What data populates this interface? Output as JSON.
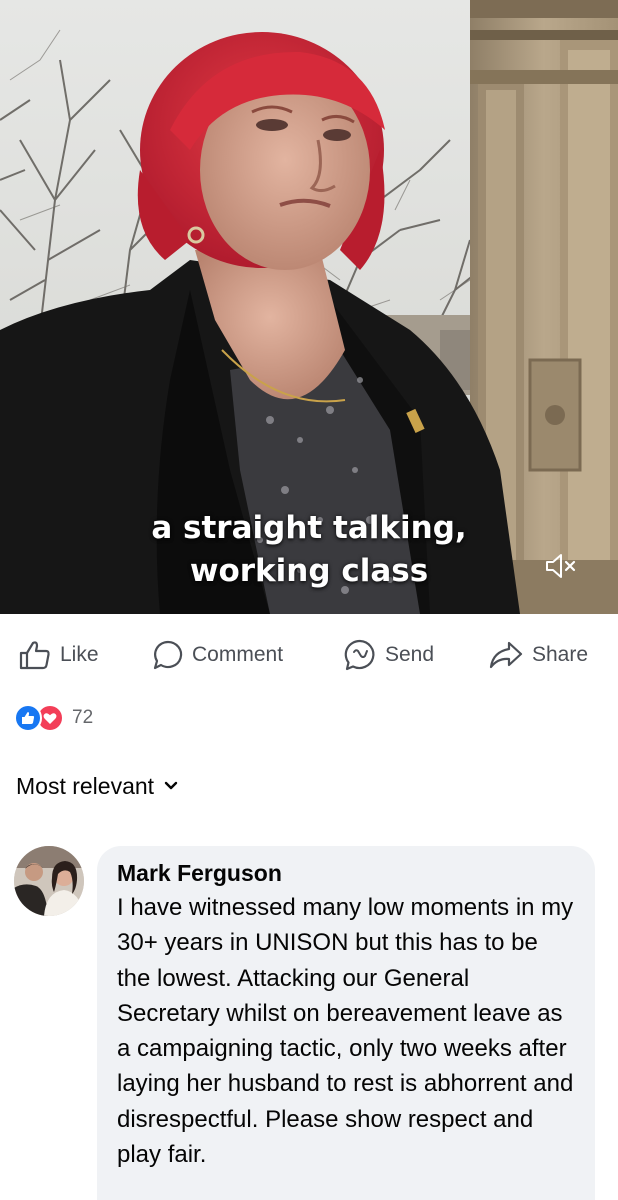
{
  "video": {
    "caption_line1": "a straight talking,",
    "caption_line2": "working class",
    "mute_icon": "speaker-muted-icon"
  },
  "actions": {
    "like_label": "Like",
    "comment_label": "Comment",
    "send_label": "Send",
    "share_label": "Share"
  },
  "reactions": {
    "count": "72",
    "types": [
      "like",
      "love"
    ]
  },
  "comments_sort": {
    "label": "Most relevant"
  },
  "comment": {
    "author": "Mark Ferguson",
    "text": "I have witnessed many low moments in my 30+ years in UNISON  but this has to be the lowest. Attacking our General Secretary whilst on bereavement leave as a campaigning tactic, only two weeks after laying her husband to rest is abhorrent and disrespectful. Please show respect and play fair."
  },
  "colors": {
    "like_blue": "#1877f2",
    "love_red": "#f33e58",
    "bubble_bg": "#f0f2f5",
    "action_text": "#4b4f56"
  }
}
